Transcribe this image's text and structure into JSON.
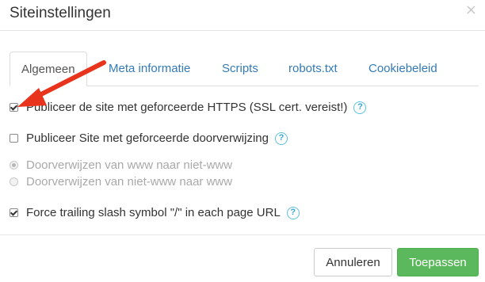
{
  "dialog": {
    "title": "Siteinstellingen",
    "close_symbol": "×"
  },
  "tabs": [
    {
      "label": "Algemeen",
      "active": true
    },
    {
      "label": "Meta informatie",
      "active": false
    },
    {
      "label": "Scripts",
      "active": false
    },
    {
      "label": "robots.txt",
      "active": false
    },
    {
      "label": "Cookiebeleid",
      "active": false
    }
  ],
  "options": {
    "https": {
      "label": "Publiceer de site met geforceerde HTTPS (SSL cert. vereist!)",
      "checked": true,
      "help": "?"
    },
    "redirect": {
      "label": "Publiceer Site met geforceerde doorverwijzing",
      "checked": false,
      "help": "?"
    },
    "radio_www_to_nonwww": {
      "label": "Doorverwijzen van www naar niet-www",
      "selected": true,
      "disabled": true
    },
    "radio_nonwww_to_www": {
      "label": "Doorverwijzen van niet-www naar www",
      "selected": false,
      "disabled": true
    },
    "trailing_slash": {
      "label": "Force trailing slash symbol \"/\" in each page URL",
      "checked": true,
      "help": "?"
    }
  },
  "footer": {
    "cancel_label": "Annuleren",
    "apply_label": "Toepassen"
  },
  "colors": {
    "link": "#337ab7",
    "apply_button": "#5cb85c",
    "help_icon": "#5bc0de",
    "annotation_arrow": "#e8341c"
  },
  "annotation": {
    "icon": "red-arrow-annotation"
  }
}
